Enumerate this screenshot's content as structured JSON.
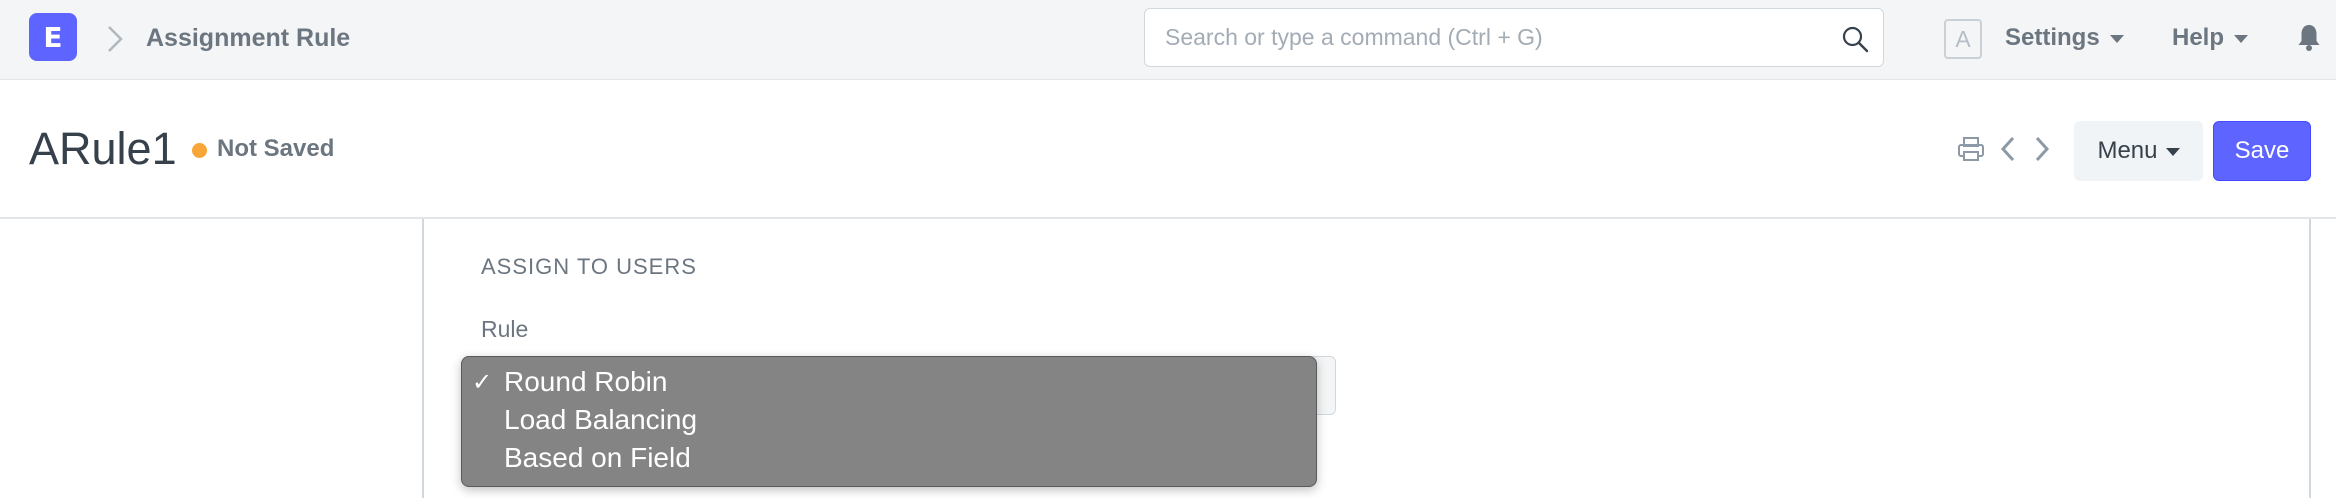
{
  "navbar": {
    "logo_letter": "E",
    "breadcrumb": "Assignment Rule",
    "search_placeholder": "Search or type a command (Ctrl + G)",
    "avatar_letter": "A",
    "settings_label": "Settings",
    "help_label": "Help"
  },
  "page_head": {
    "title": "ARule1",
    "status": "Not Saved",
    "status_color": "#f8a637",
    "menu_label": "Menu",
    "save_label": "Save"
  },
  "form": {
    "section_heading": "ASSIGN TO USERS",
    "rule_label": "Rule",
    "rule_selected": "Round Robin",
    "rule_options": [
      {
        "label": "Round Robin",
        "checked": true
      },
      {
        "label": "Load Balancing",
        "checked": false
      },
      {
        "label": "Based on Field",
        "checked": false
      }
    ]
  },
  "colors": {
    "accent": "#5e64ff",
    "dropdown_bg": "#848484"
  }
}
